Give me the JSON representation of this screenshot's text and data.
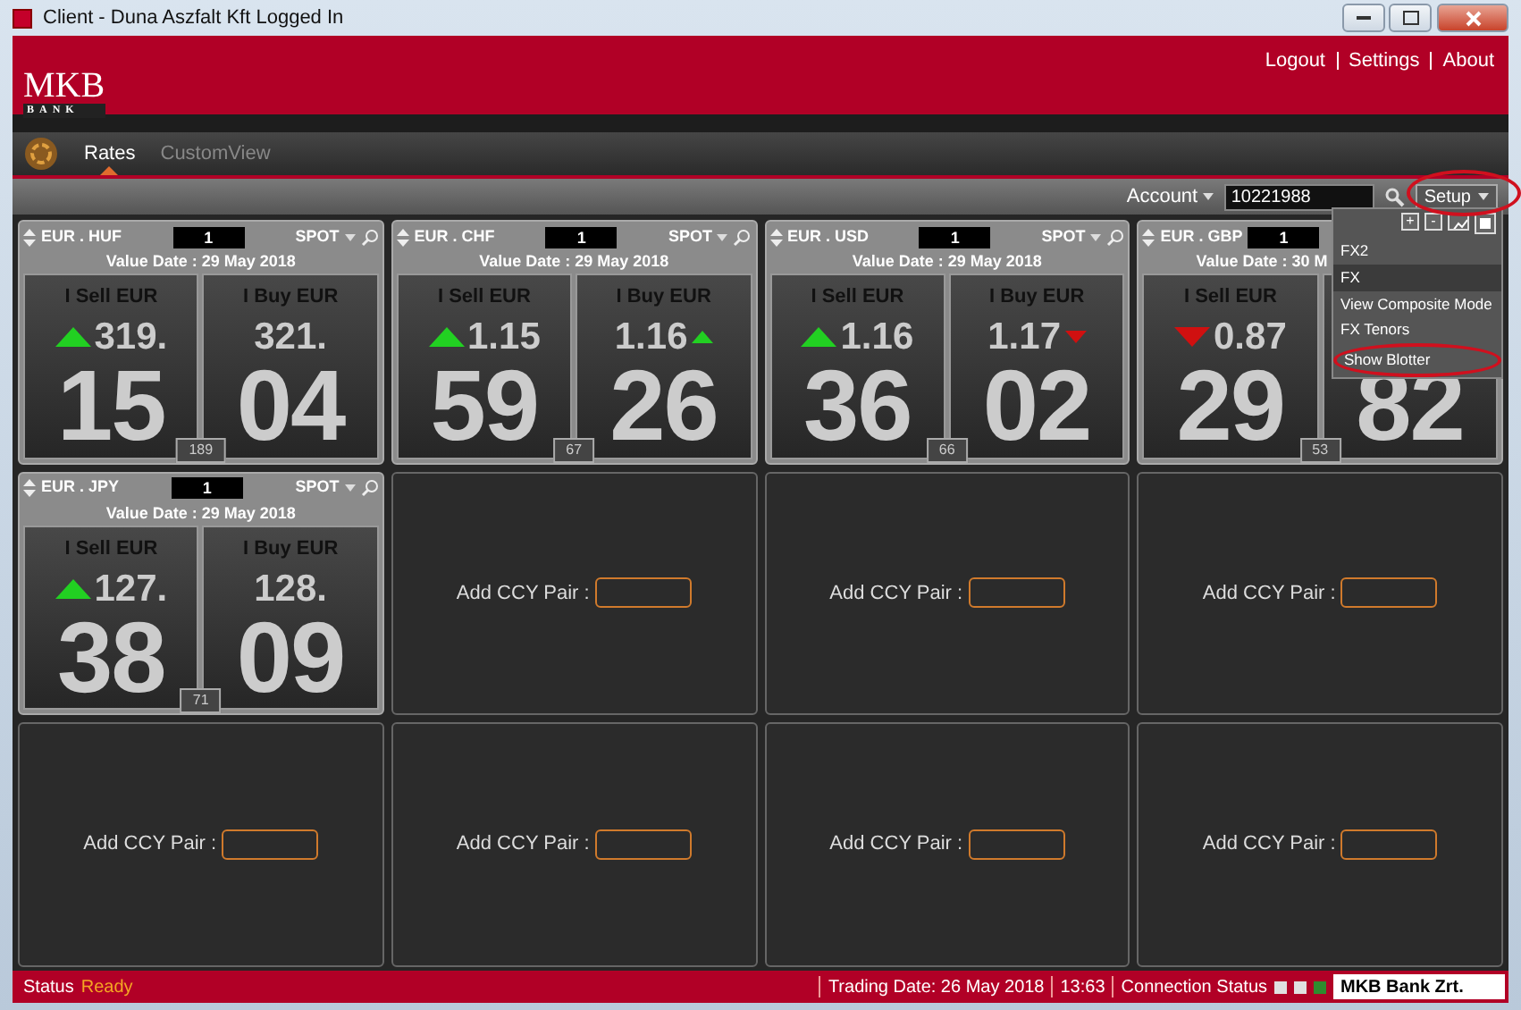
{
  "window": {
    "title": "Client - Duna Aszfalt Kft Logged In"
  },
  "header": {
    "logo_top": "MKB",
    "logo_bottom": "BANK",
    "links": [
      "Logout",
      "Settings",
      "About"
    ]
  },
  "tabs": [
    {
      "label": "Rates",
      "selected": true
    },
    {
      "label": "CustomView",
      "selected": false
    }
  ],
  "toolbar": {
    "account_label": "Account",
    "account_value": "10221988",
    "setup": "Setup"
  },
  "tiles": [
    {
      "kind": "pair",
      "pair": "EUR . HUF",
      "amount": "1",
      "tenor": "SPOT",
      "value_date": "Value Date : 29 May 2018",
      "sell": {
        "label": "I Sell EUR",
        "prefix": "319.",
        "digits": "15",
        "rising": true
      },
      "buy": {
        "label": "I Buy EUR",
        "prefix": "321.",
        "digits": "04"
      },
      "spread": "189"
    },
    {
      "kind": "pair",
      "pair": "EUR . CHF",
      "amount": "1",
      "tenor": "SPOT",
      "value_date": "Value Date : 29 May 2018",
      "sell": {
        "label": "I Sell EUR",
        "prefix": "1.15",
        "digits": "59",
        "rising": true
      },
      "buy": {
        "label": "I Buy EUR",
        "prefix": "1.16",
        "digits": "26",
        "rising": true
      },
      "spread": "67"
    },
    {
      "kind": "pair",
      "pair": "EUR . USD",
      "amount": "1",
      "tenor": "SPOT",
      "value_date": "Value Date : 29 May 2018",
      "sell": {
        "label": "I Sell EUR",
        "prefix": "1.16",
        "digits": "36",
        "rising": true
      },
      "buy": {
        "label": "I Buy EUR",
        "prefix": "1.17",
        "digits": "02",
        "rising": false
      },
      "spread": "66"
    },
    {
      "kind": "pair",
      "pair": "EUR . GBP",
      "amount": "1",
      "value_date": "Value Date : 30 M",
      "sell": {
        "label": "I Sell EUR",
        "prefix": "0.87",
        "digits": "29",
        "rising": false
      },
      "buy": {
        "digits": "82"
      },
      "spread": "53"
    },
    {
      "kind": "pair",
      "pair": "EUR . JPY",
      "amount": "1",
      "tenor": "SPOT",
      "value_date": "Value Date : 29 May 2018",
      "sell": {
        "label": "I Sell EUR",
        "prefix": "127.",
        "digits": "38",
        "rising": true
      },
      "buy": {
        "label": "I Buy EUR",
        "prefix": "128.",
        "digits": "09"
      },
      "spread": "71"
    },
    {
      "kind": "empty",
      "label": "Add CCY Pair :"
    },
    {
      "kind": "empty",
      "label": "Add CCY Pair :"
    },
    {
      "kind": "empty",
      "label": "Add CCY Pair :"
    },
    {
      "kind": "empty",
      "label": "Add CCY Pair :"
    },
    {
      "kind": "empty",
      "label": "Add CCY Pair :"
    },
    {
      "kind": "empty",
      "label": "Add CCY Pair :"
    },
    {
      "kind": "empty",
      "label": "Add CCY Pair :"
    }
  ],
  "setup_menu": {
    "tools": [
      "+",
      "-"
    ],
    "items": [
      {
        "label": "FX2",
        "selected": false,
        "circled": false
      },
      {
        "label": "FX",
        "selected": true,
        "circled": false
      },
      {
        "label": "View Composite Mode",
        "selected": false,
        "circled": false
      },
      {
        "label": "FX Tenors",
        "selected": false,
        "circled": false
      },
      {
        "label": "Show Blotter",
        "selected": false,
        "circled": true
      }
    ]
  },
  "status_bar": {
    "label": "Status",
    "state": "Ready",
    "trading_date": "Trading Date: 26 May 2018",
    "time": "13:63",
    "connection_label": "Connection Status",
    "connection_lights": [
      {
        "color": "#e0e0e0"
      },
      {
        "color": "#e0e0e0"
      },
      {
        "color": "#2e8b2e"
      }
    ],
    "company": "MKB Bank Zrt."
  }
}
